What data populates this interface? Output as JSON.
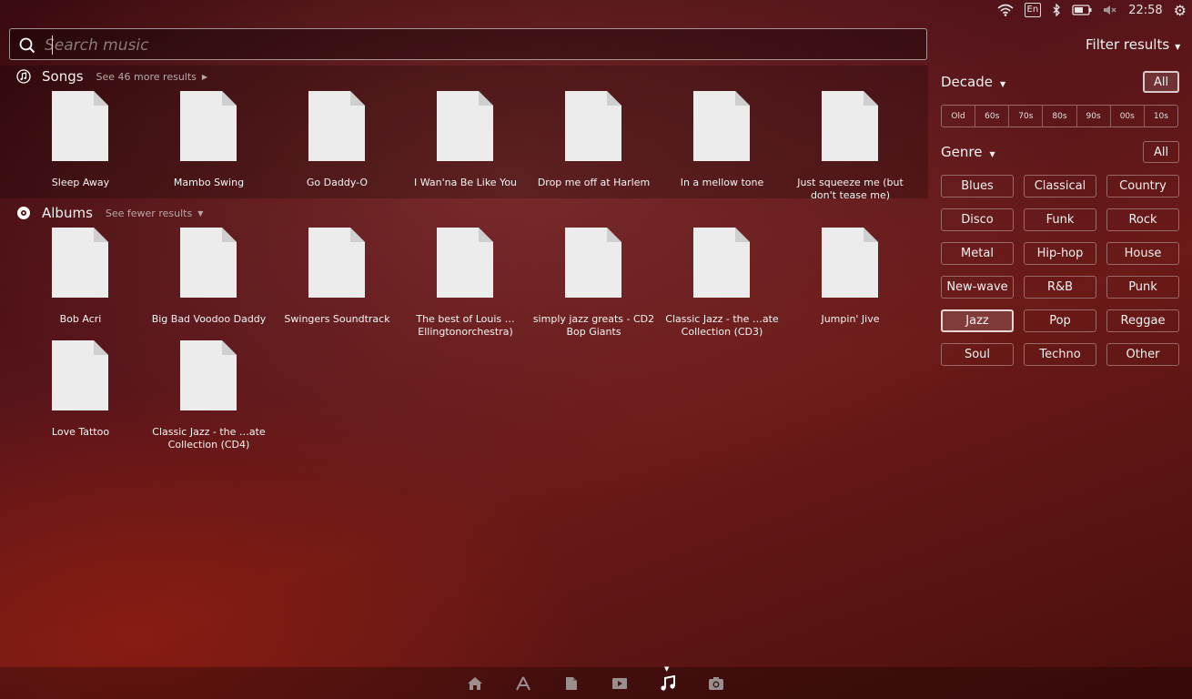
{
  "panel": {
    "keyboard_layout": "En",
    "clock": "22:58"
  },
  "search": {
    "placeholder": "Search music",
    "value": ""
  },
  "songs": {
    "title": "Songs",
    "see_more": "See 46 more results",
    "items": [
      "Sleep Away",
      "Mambo Swing",
      "Go Daddy-O",
      "I Wan'na Be Like You",
      "Drop me off at Harlem",
      "In a mellow tone",
      "Just squeeze me (but don't tease me)"
    ]
  },
  "albums": {
    "title": "Albums",
    "see_fewer": "See fewer results",
    "items": [
      "Bob Acri",
      "Big Bad Voodoo Daddy",
      "Swingers Soundtrack",
      "The best of Louis … Ellingtonorchestra)",
      "simply jazz greats - CD2 Bop Giants",
      "Classic Jazz - the …ate Collection (CD3)",
      "Jumpin' Jive",
      "Love Tattoo",
      "Classic Jazz - the …ate Collection (CD4)"
    ]
  },
  "filters": {
    "title": "Filter results",
    "decade": {
      "label": "Decade",
      "all_label": "All",
      "all_active": true,
      "options": [
        "Old",
        "60s",
        "70s",
        "80s",
        "90s",
        "00s",
        "10s"
      ]
    },
    "genre": {
      "label": "Genre",
      "all_label": "All",
      "selected": "Jazz",
      "options": [
        "Blues",
        "Classical",
        "Country",
        "Disco",
        "Funk",
        "Rock",
        "Metal",
        "Hip-hop",
        "House",
        "New-wave",
        "R&B",
        "Punk",
        "Jazz",
        "Pop",
        "Reggae",
        "Soul",
        "Techno",
        "Other"
      ]
    }
  },
  "dock": {
    "active": "music-lens",
    "lenses": [
      "home-lens",
      "applications-lens",
      "files-lens",
      "video-lens",
      "music-lens",
      "photos-lens"
    ]
  },
  "colors": {
    "background": "#55141a",
    "text": "#ffffff",
    "muted_text": "#b8a8a6"
  }
}
